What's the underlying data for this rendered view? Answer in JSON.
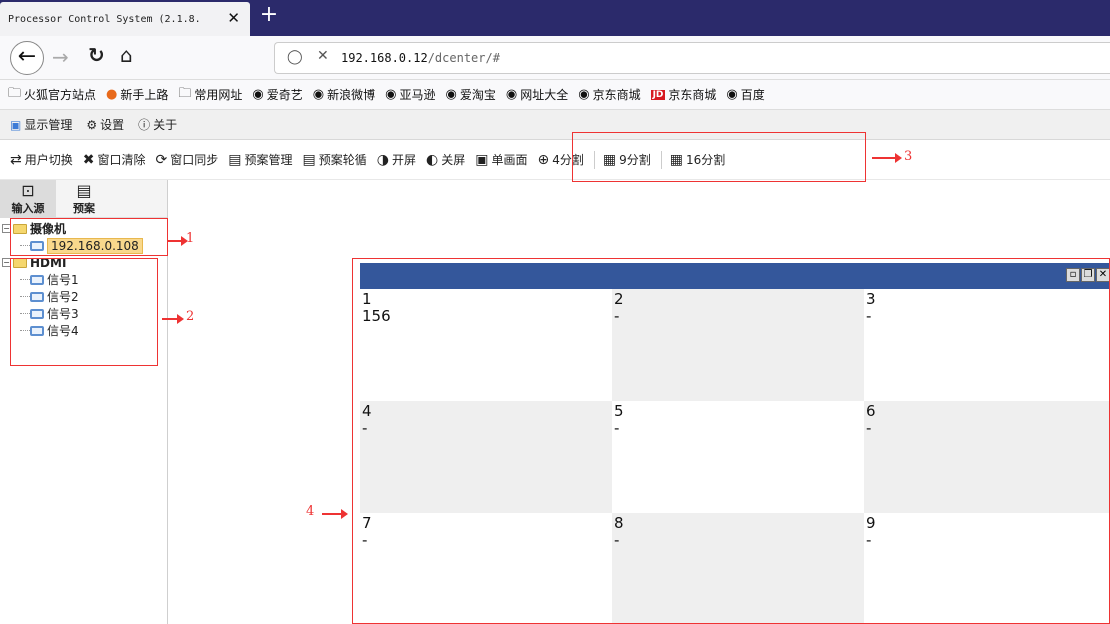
{
  "browser": {
    "tab_title": "Processor Control System (2.1.8.",
    "tab_close": "✕",
    "new_tab": "+",
    "url_host": "192.168.0.12",
    "url_path": "/dcenter/#"
  },
  "bookmarks": [
    {
      "icon": "folder-icon",
      "label": "火狐官方站点"
    },
    {
      "icon": "firefox-icon",
      "label": "新手上路"
    },
    {
      "icon": "folder-icon",
      "label": "常用网址"
    },
    {
      "icon": "globe-icon",
      "label": "爱奇艺"
    },
    {
      "icon": "globe-icon",
      "label": "新浪微博"
    },
    {
      "icon": "globe-icon",
      "label": "亚马逊"
    },
    {
      "icon": "globe-icon",
      "label": "爱淘宝"
    },
    {
      "icon": "globe-icon",
      "label": "网址大全"
    },
    {
      "icon": "globe-icon",
      "label": "京东商城"
    },
    {
      "icon": "jd-icon",
      "label": "京东商城"
    },
    {
      "icon": "globe-icon",
      "label": "百度"
    }
  ],
  "app_menu": [
    {
      "icon": "monitor-icon",
      "label": "显示管理"
    },
    {
      "icon": "gear-icon",
      "label": "设置"
    },
    {
      "icon": "info-icon",
      "label": "关于"
    }
  ],
  "toolbar": [
    {
      "icon": "user-switch-icon",
      "label": "用户切换"
    },
    {
      "icon": "clear-icon",
      "label": "窗口清除"
    },
    {
      "icon": "sync-icon",
      "label": "窗口同步"
    },
    {
      "icon": "preset-icon",
      "label": "预案管理"
    },
    {
      "icon": "preset-loop-icon",
      "label": "预案轮循"
    },
    {
      "icon": "power-on-icon",
      "label": "开屏"
    },
    {
      "icon": "power-off-icon",
      "label": "关屏"
    },
    {
      "icon": "single-view-icon",
      "label": "单画面"
    },
    {
      "icon": "split-4-icon",
      "label": "4分割"
    },
    {
      "icon": "split-9-icon",
      "label": "9分割"
    },
    {
      "icon": "split-16-icon",
      "label": "16分割"
    }
  ],
  "left_tabs": [
    {
      "icon": "input-source-icon",
      "label": "输入源"
    },
    {
      "icon": "preset-icon",
      "label": "预案"
    }
  ],
  "tree": {
    "camera_group": "摄像机",
    "camera_item": "192.168.0.108",
    "hdmi_group": "HDMI",
    "hdmi_items": [
      "信号1",
      "信号2",
      "信号3",
      "信号4"
    ]
  },
  "annotations": [
    "1",
    "2",
    "3",
    "4"
  ],
  "grid_cells": [
    {
      "num": "1",
      "val": "156"
    },
    {
      "num": "2",
      "val": "-"
    },
    {
      "num": "3",
      "val": "-"
    },
    {
      "num": "4",
      "val": "-"
    },
    {
      "num": "5",
      "val": "-"
    },
    {
      "num": "6",
      "val": "-"
    },
    {
      "num": "7",
      "val": "-"
    },
    {
      "num": "8",
      "val": "-"
    },
    {
      "num": "9",
      "val": "-"
    }
  ],
  "colors": {
    "tabstrip": "#2b2a6b",
    "display_title": "#34579b",
    "annotation": "#e33333",
    "selected_node": "#f9d88c"
  }
}
